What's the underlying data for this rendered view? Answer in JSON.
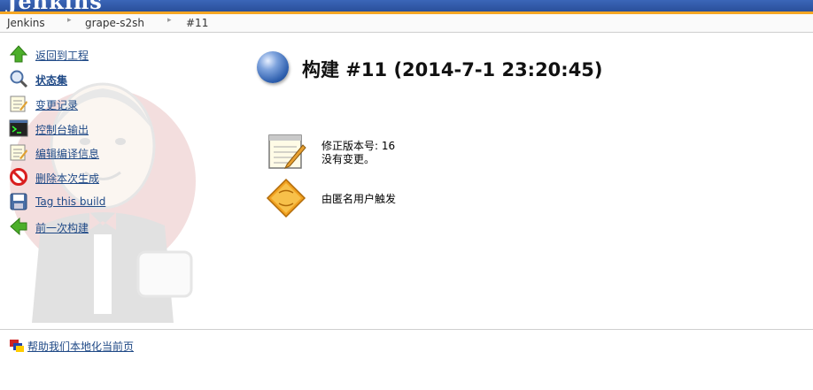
{
  "header": {
    "logo": "Jenkins"
  },
  "breadcrumb": {
    "items": [
      "Jenkins",
      "grape-s2sh",
      "#11"
    ],
    "separator": "▸"
  },
  "sidebar": {
    "items": [
      {
        "label": "返回到工程",
        "icon": "up-arrow-icon"
      },
      {
        "label": "状态集",
        "icon": "magnifier-icon"
      },
      {
        "label": "变更记录",
        "icon": "notepad-icon"
      },
      {
        "label": "控制台输出",
        "icon": "terminal-icon"
      },
      {
        "label": "编辑编译信息",
        "icon": "notepad-icon"
      },
      {
        "label": "删除本次生成",
        "icon": "no-entry-icon"
      },
      {
        "label": "Tag this build",
        "icon": "save-icon"
      },
      {
        "label": "前一次构建",
        "icon": "left-arrow-icon"
      }
    ]
  },
  "main": {
    "title": "构建 #11 (2014-7-1 23:20:45)",
    "status_color": "#2e5fae",
    "changes": {
      "revision_text": "修正版本号: 16",
      "no_changes_text": "没有变更。"
    },
    "cause": {
      "text": "由匿名用户触发"
    }
  },
  "footer": {
    "localize_link": "帮助我们本地化当前页"
  },
  "colors": {
    "link": "#204a87",
    "header": "#2a4f9a",
    "accent": "#f5a623"
  }
}
